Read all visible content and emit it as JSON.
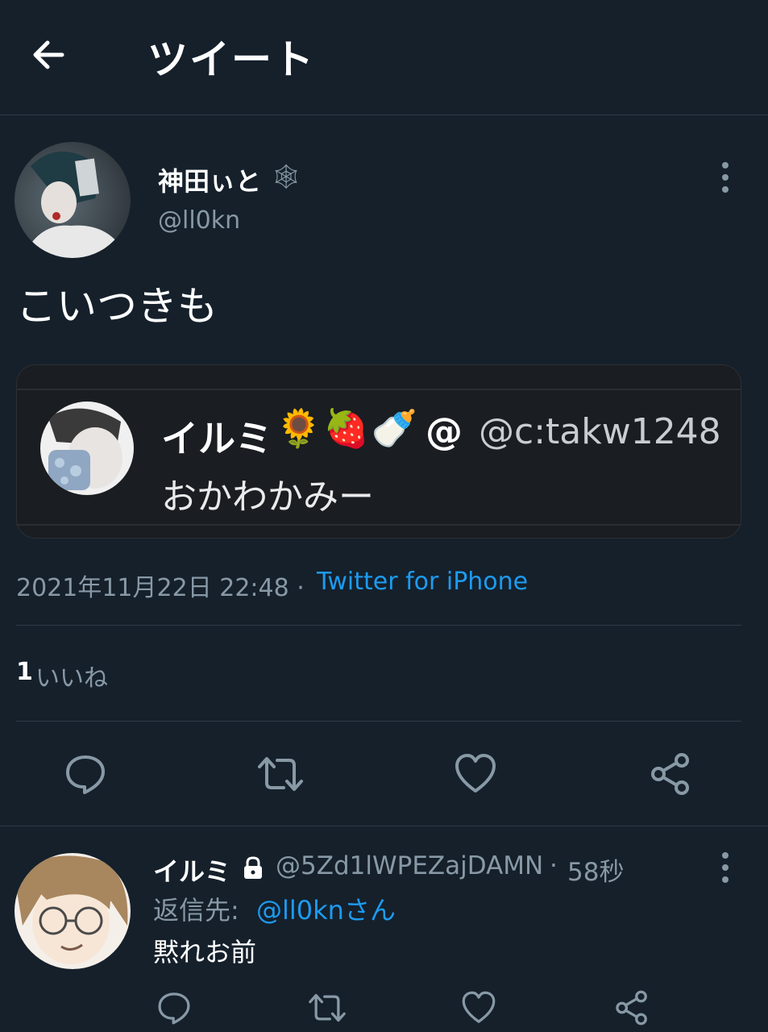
{
  "header": {
    "title": "ツイート",
    "back_icon": "arrow-left-icon"
  },
  "tweet": {
    "author_name": "神田ぃと",
    "author_emoji": "🕸",
    "author_handle": "@ll0kn",
    "text": "こいつきも",
    "quote": {
      "name": "イルミ",
      "emojis": "🌻🍓🍼",
      "at": "@",
      "handle": "@c:takw1248",
      "text": "おかわかみー"
    },
    "timestamp": "2021年11月22日 22:48 ·",
    "source": "Twitter for iPhone",
    "likes_count": "1",
    "likes_label": "いいね"
  },
  "reply": {
    "author_name": "イルミ",
    "handle": "@5Zd1lWPEZajDAMN",
    "dot": "·",
    "time": "58秒",
    "reply_to_label": "返信先:",
    "reply_to_handle": "@ll0knさん",
    "text": "黙れお前"
  },
  "colors": {
    "background": "#15202b",
    "link": "#1d9bf0",
    "muted": "#8899a6",
    "divider": "#2f3b47"
  }
}
